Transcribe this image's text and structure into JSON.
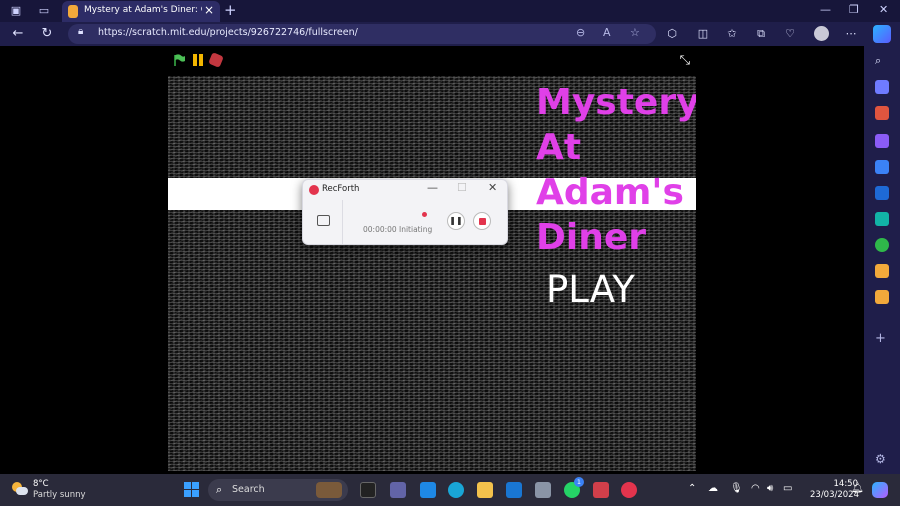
{
  "browser": {
    "tab_title": "Mystery at Adam's Diner: Official",
    "url": "https://scratch.mit.edu/projects/926722746/fullscreen/"
  },
  "game": {
    "title_lines": [
      "Mystery",
      "At",
      "Adam's",
      "Diner"
    ],
    "play_label": "PLAY",
    "title_color": "#e040e8"
  },
  "recorder": {
    "app_name": "RecForth",
    "timer": "00:00:00",
    "status": "Initiating",
    "accent": "#e3344d"
  },
  "taskbar": {
    "weather_temp": "8°C",
    "weather_condition": "Partly sunny",
    "search_placeholder": "Search",
    "time": "14:50",
    "date": "23/03/2024",
    "whatsapp_badge": "1"
  }
}
